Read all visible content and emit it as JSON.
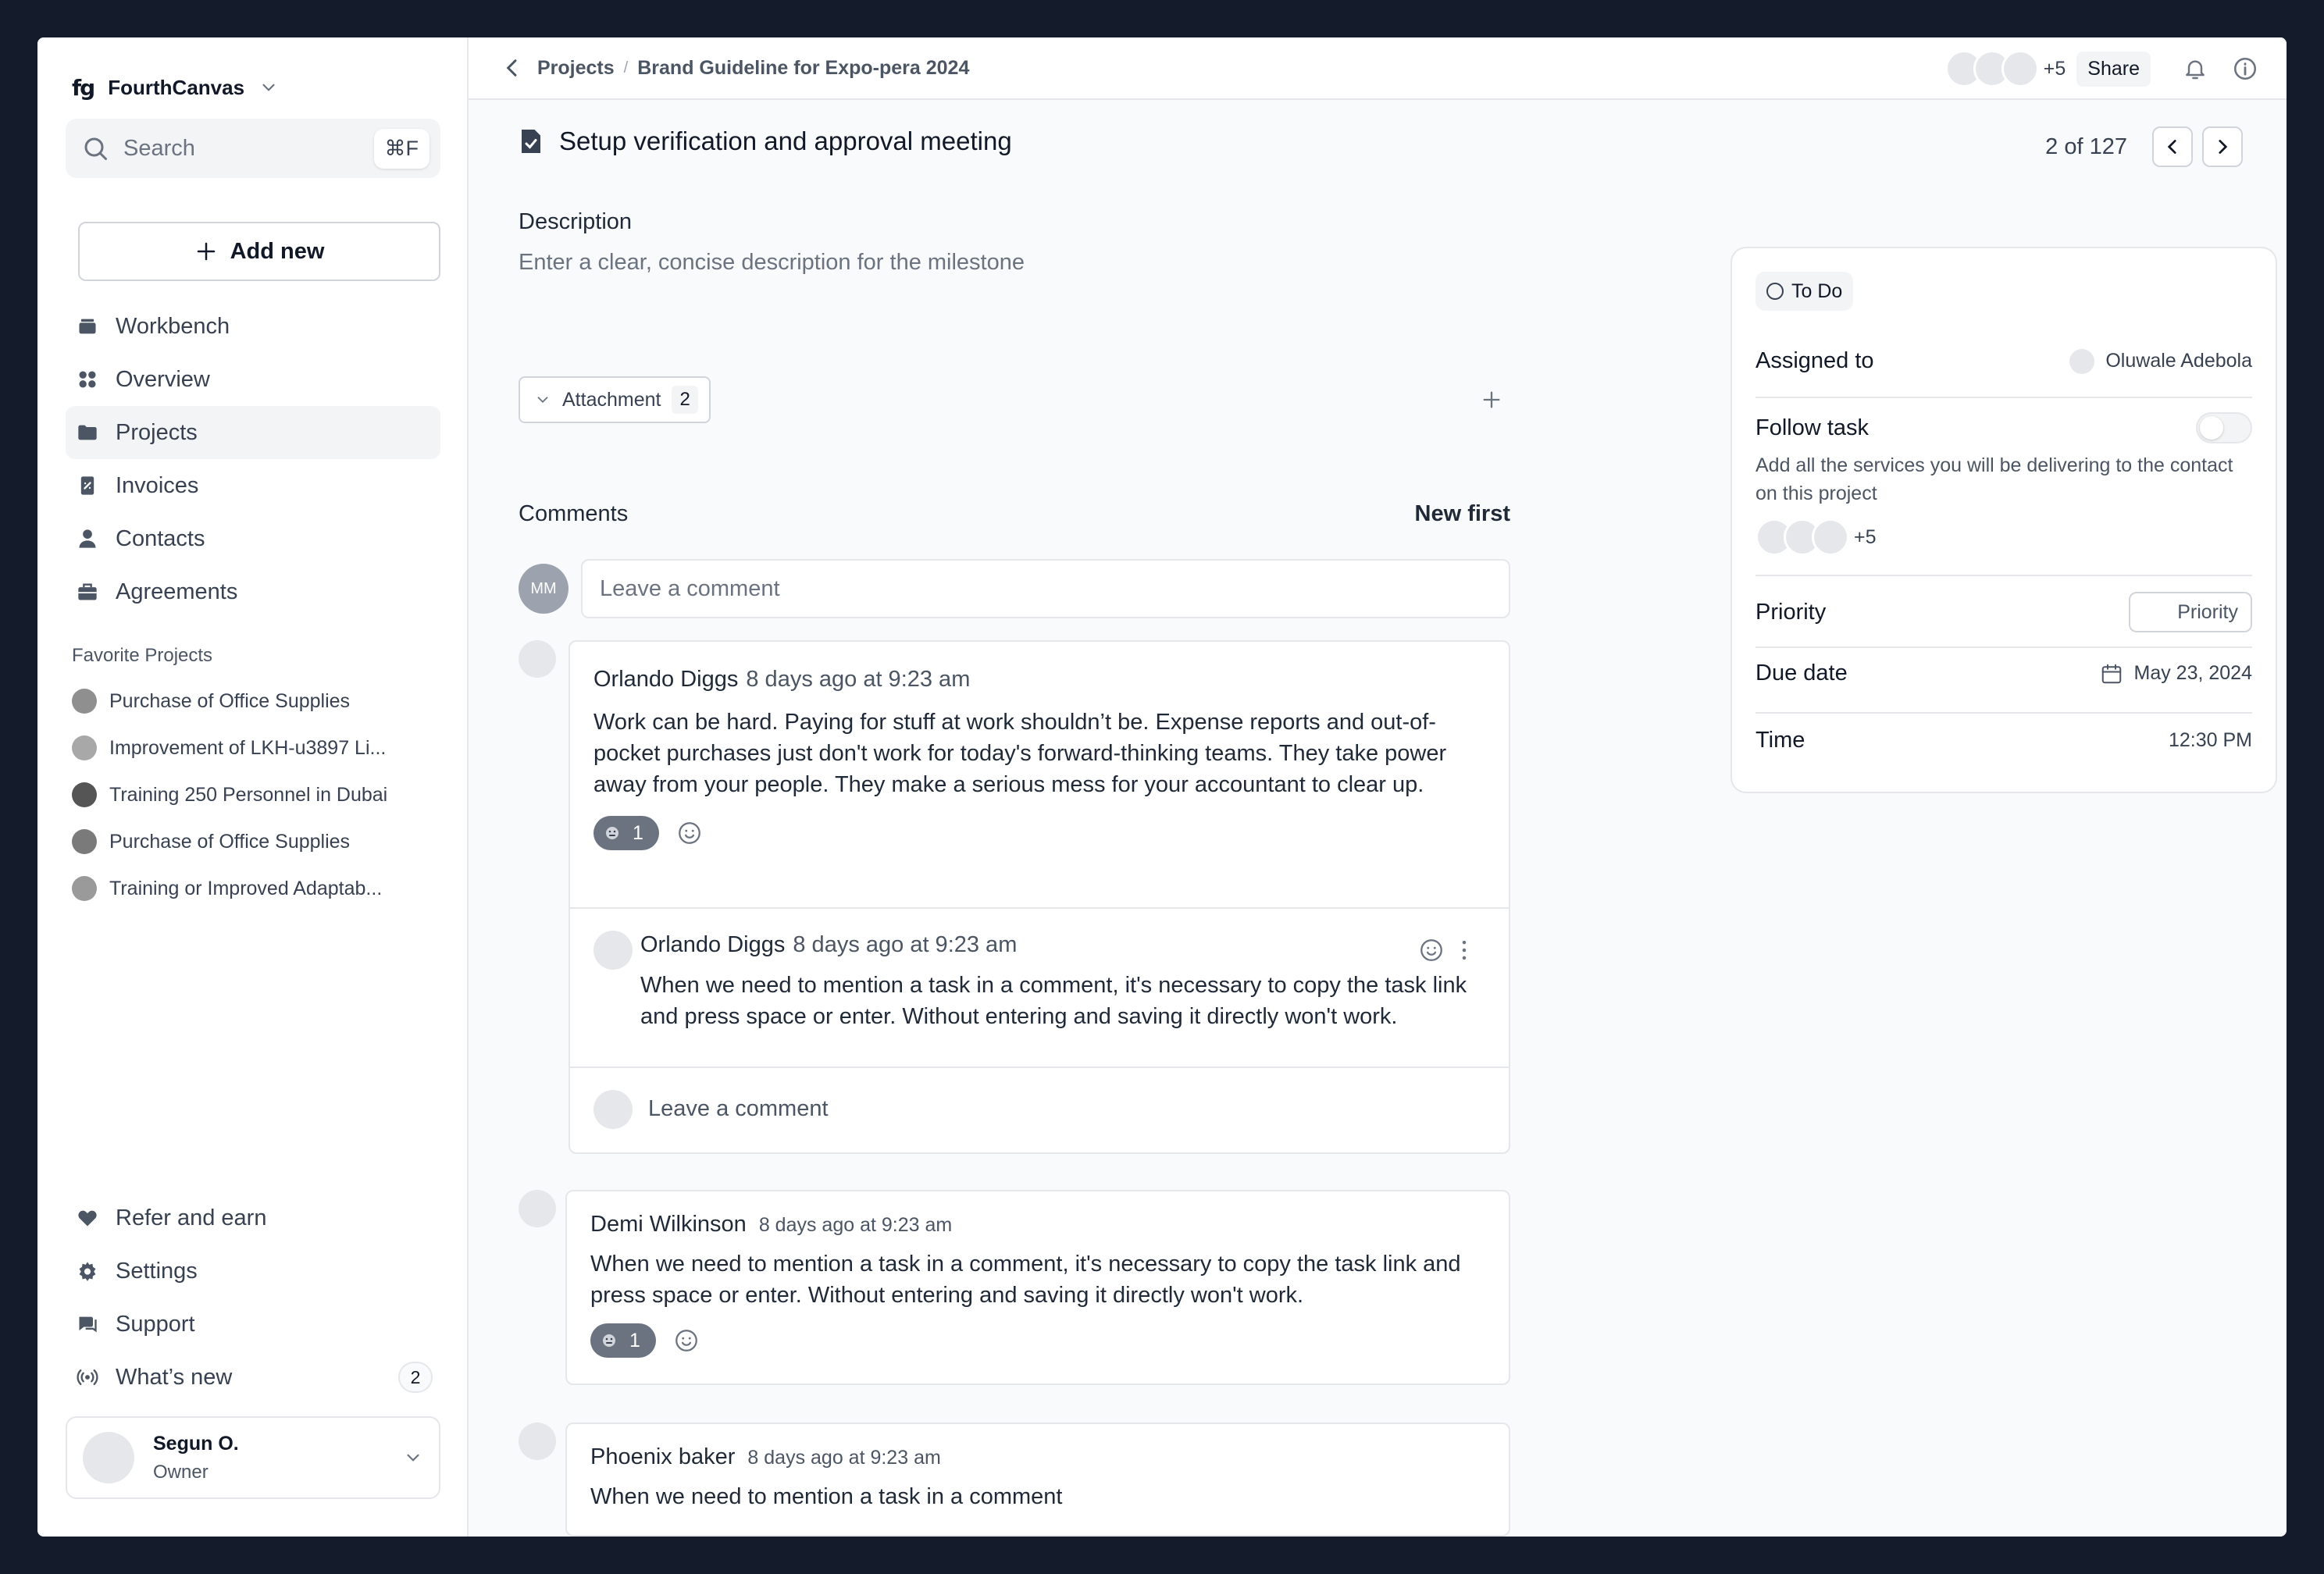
{
  "sidebar": {
    "brand": {
      "logo": "fg",
      "name": "FourthCanvas"
    },
    "search": {
      "placeholder": "Search",
      "shortcut": "⌘F"
    },
    "add_new_label": "Add new",
    "nav": [
      {
        "label": "Workbench",
        "icon": "workbench-icon"
      },
      {
        "label": "Overview",
        "icon": "grid-icon"
      },
      {
        "label": "Projects",
        "icon": "folder-icon",
        "active": true
      },
      {
        "label": "Invoices",
        "icon": "invoice-icon"
      },
      {
        "label": "Contacts",
        "icon": "user-icon"
      },
      {
        "label": "Agreements",
        "icon": "briefcase-icon"
      }
    ],
    "favorites_title": "Favorite Projects",
    "favorites": [
      {
        "label": "Purchase of Office Supplies",
        "color": "#8f8f8f"
      },
      {
        "label": "Improvement of LKH-u3897 Li...",
        "color": "#a8a8a8"
      },
      {
        "label": "Training 250 Personnel in Dubai",
        "color": "#555555"
      },
      {
        "label": "Purchase of Office Supplies",
        "color": "#7a7a7a"
      },
      {
        "label": "Training or Improved Adaptab...",
        "color": "#9a9a9a"
      }
    ],
    "bottom_nav": [
      {
        "label": "Refer and earn",
        "icon": "heart-icon"
      },
      {
        "label": "Settings",
        "icon": "gear-icon"
      },
      {
        "label": "Support",
        "icon": "chat-icon"
      },
      {
        "label": "What’s new",
        "icon": "broadcast-icon",
        "badge": "2"
      }
    ],
    "user": {
      "name": "Segun O.",
      "role": "Owner"
    }
  },
  "header": {
    "breadcrumb": [
      "Projects",
      "Brand Guideline for Expo-pera 2024"
    ],
    "separator": "/",
    "members_more": "+5",
    "share_label": "Share"
  },
  "task": {
    "title": "Setup verification and approval meeting",
    "pager": "2 of 127",
    "description_label": "Description",
    "description_placeholder": "Enter a clear, concise description for the milestone",
    "attachment_label": "Attachment",
    "attachment_count": "2"
  },
  "comments": {
    "label": "Comments",
    "sort": "New first",
    "composer_initials": "MM",
    "composer_placeholder": "Leave a comment",
    "items": [
      {
        "author": "Orlando Diggs",
        "time": "8 days ago at 9:23 am",
        "body": "Work can be hard. Paying for stuff at work shouldn’t be. Expense reports and out-of-pocket purchases just don't work for today's forward-thinking teams. They take power away from your people. They make a serious mess for your accountant to clear up.",
        "reaction_count": "1",
        "reply": {
          "author": "Orlando Diggs",
          "time": "8 days ago at 9:23 am",
          "body": "When we need to mention a task in a comment, it's necessary to copy the task link and press space or enter. Without entering and saving it directly won't work."
        },
        "reply_placeholder": "Leave a comment"
      },
      {
        "author": "Demi Wilkinson",
        "time": "8 days ago at 9:23 am",
        "body": "When we need to mention a task in a comment, it's necessary to copy the task link and press space or enter. Without entering and saving it directly won't work.",
        "reaction_count": "1"
      },
      {
        "author": "Phoenix baker",
        "time": "8 days ago at 9:23 am",
        "body": "When we need to mention a task in a comment"
      }
    ]
  },
  "details": {
    "status": "To Do",
    "assigned_label": "Assigned to",
    "assignee": "Oluwale Adebola",
    "follow_label": "Follow task",
    "follow_enabled": false,
    "follow_desc": "Add all the services you will be delivering to the contact on this project",
    "followers_more": "+5",
    "priority_label": "Priority",
    "priority_value": "Priority",
    "due_label": "Due date",
    "due_value": "May 23, 2024",
    "time_label": "Time",
    "time_value": "12:30 PM"
  },
  "colors": {
    "frame": "#141b2b",
    "reaction_pill": "#6b7280",
    "accent_text": "#111827"
  }
}
